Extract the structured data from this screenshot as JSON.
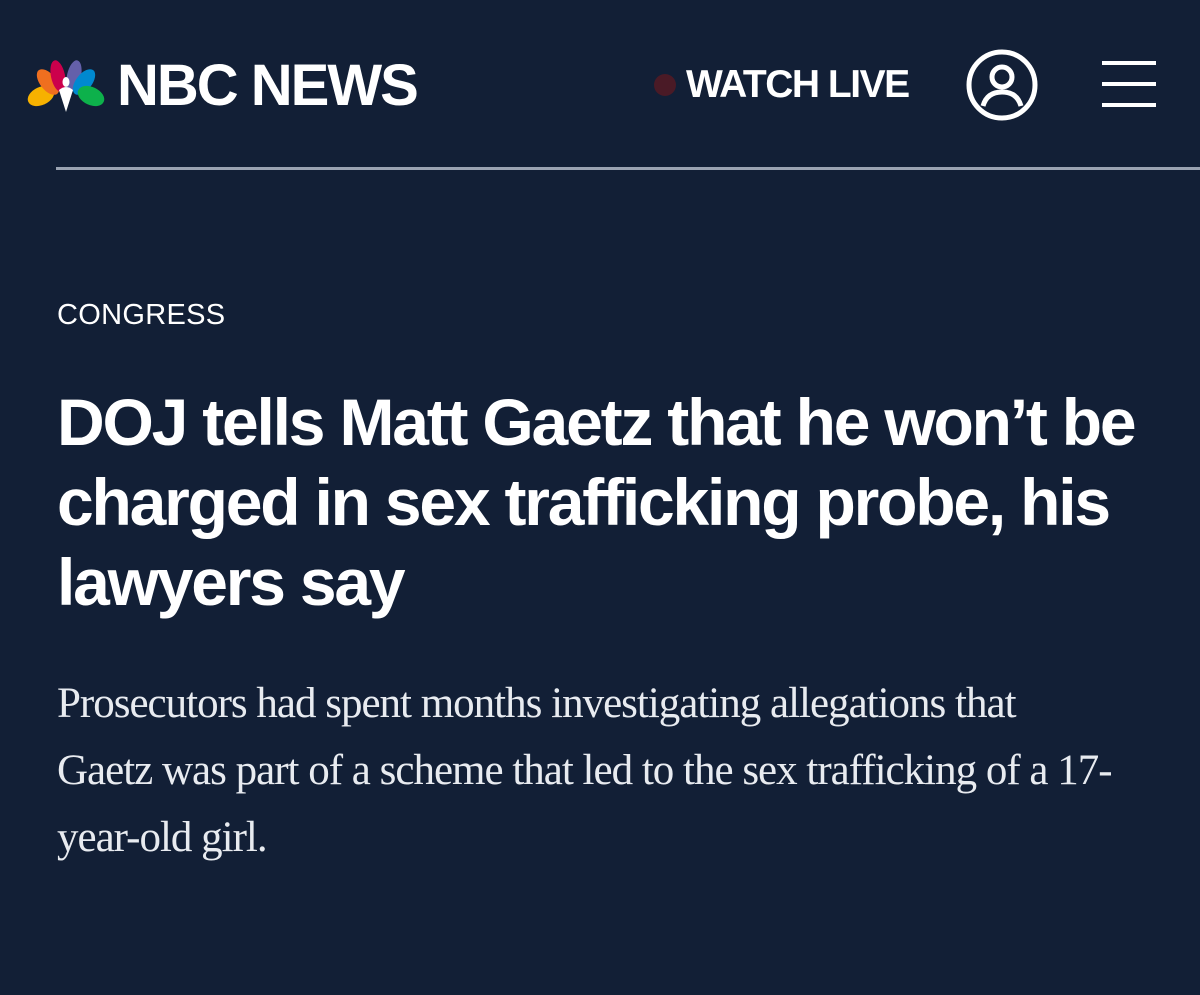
{
  "header": {
    "brand": "NBC NEWS",
    "watch_live": "WATCH LIVE",
    "live_dot_color": "#4a1a26",
    "account_icon": "user-circle-icon",
    "menu_icon": "hamburger-menu-icon"
  },
  "article": {
    "section": "CONGRESS",
    "headline": "DOJ tells Matt Gaetz that he won’t be charged in sex trafficking probe, his lawyers say",
    "dek": "Prosecutors had spent months investigating allegations that Gaetz was part of a scheme that led to the sex trafficking of a 17-year-old girl."
  },
  "colors": {
    "background": "#121f36",
    "text": "#ffffff",
    "divider": "#9aa3b2"
  }
}
